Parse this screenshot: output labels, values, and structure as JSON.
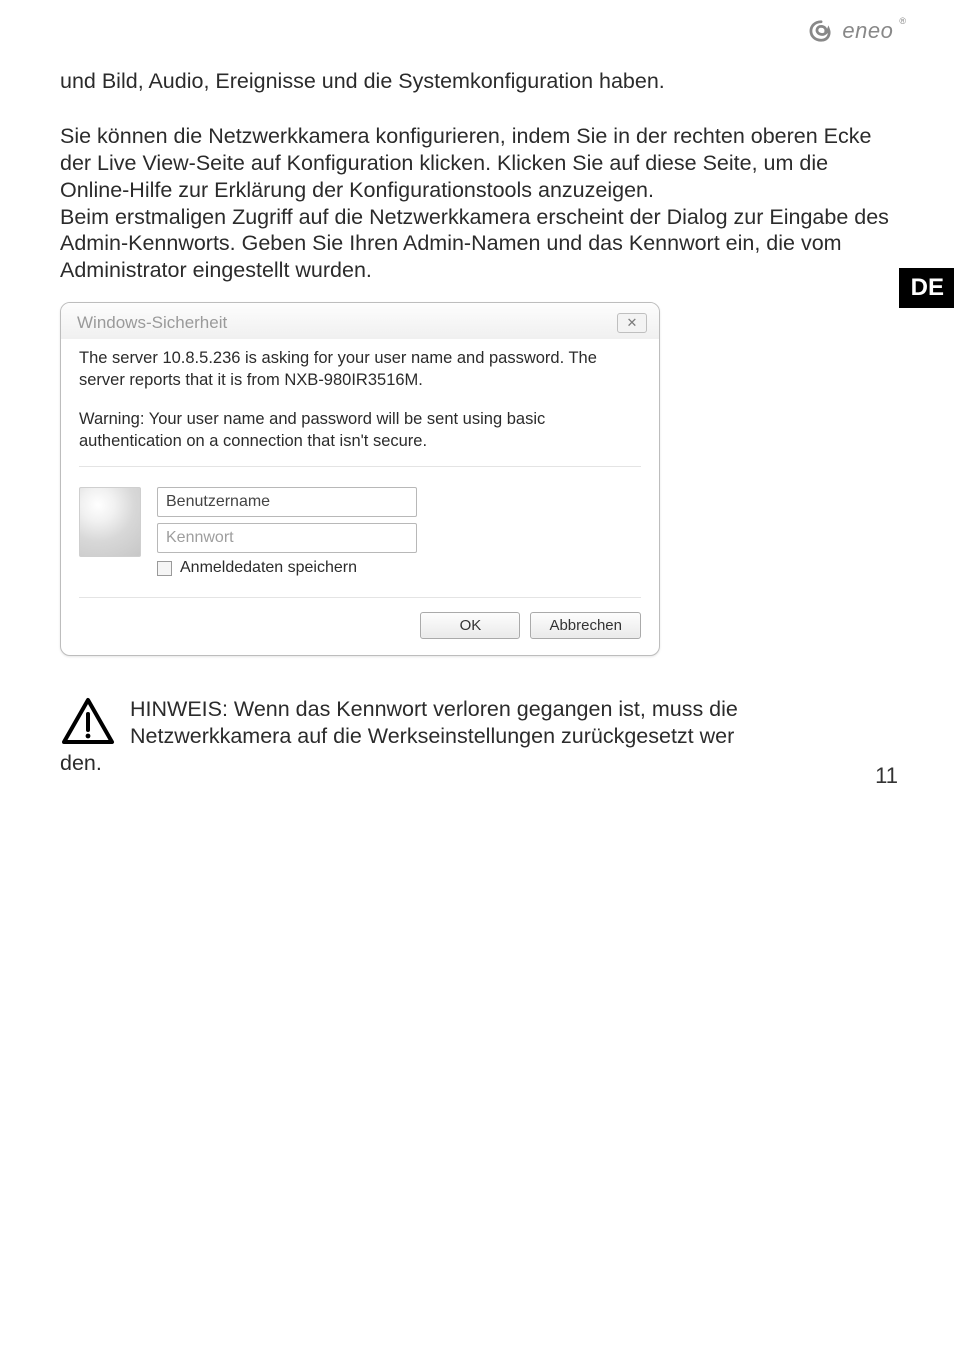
{
  "brand": {
    "name": "eneo",
    "reg": "®"
  },
  "lang_tab": "DE",
  "paragraphs": {
    "p1": "und Bild, Audio, Ereignisse und die Systemkonfiguration haben.",
    "p2": "Sie können die Netzwerkkamera konfigurieren, indem Sie in der rechten oberen Ecke der Live View-Seite auf Konfiguration klicken. Klicken Sie auf diese Seite, um die Online-Hilfe zur Erklärung der Konfigurationstools anzu­zeigen.",
    "p3": "Beim erstmaligen Zugriff auf die Netzwerkkamera erscheint der Dialog zur Eingabe des Admin-Kennworts. Geben Sie Ihren Admin-Namen und das Kennwort ein, die vom Administrator eingestellt wurden."
  },
  "dialog": {
    "title": "Windows-Sicherheit",
    "close_glyph": "✕",
    "message": "The server 10.8.5.236 is asking for your user name and password. The server reports that it is from NXB-980IR3516M.",
    "warning": "Warning: Your user name and password will be sent using basic authentication on a connection that isn't secure.",
    "username_placeholder": "Benutzername",
    "password_placeholder": "Kennwort",
    "remember_label": "Anmeldedaten speichern",
    "ok_label": "OK",
    "cancel_label": "Abbrechen"
  },
  "note": {
    "line1": "HINWEIS: Wenn das Kennwort verloren gegangen ist, muss die",
    "line2": "Netzwerkkamera auf die Werkseinstellungen zurückgesetzt wer­",
    "line3": "den."
  },
  "page_number": "11"
}
